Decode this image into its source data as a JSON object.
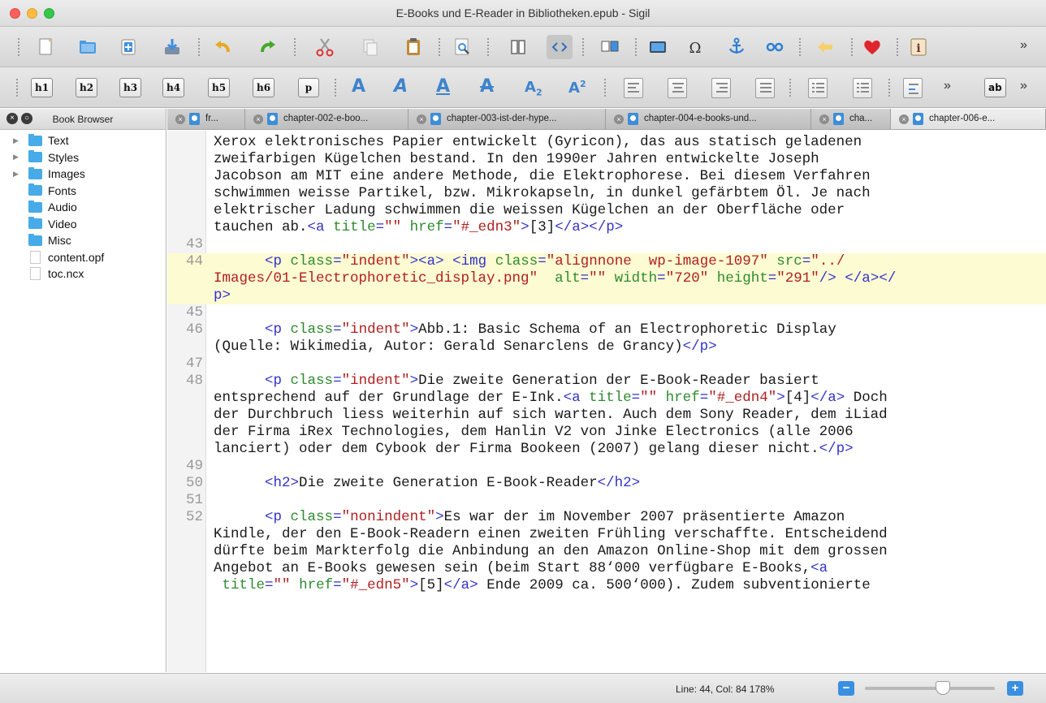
{
  "window": {
    "title": "E-Books und E-Reader in Bibliotheken.epub - Sigil"
  },
  "toolbar1": {
    "more": "»",
    "icons": [
      "new-file-icon",
      "open-folder-icon",
      "add-file-icon",
      "save-icon",
      "undo-icon",
      "redo-icon",
      "cut-icon",
      "copy-icon",
      "paste-icon",
      "find-replace-icon",
      "book-view-icon",
      "code-view-icon",
      "split-view-icon",
      "insert-image-icon",
      "special-character-icon",
      "anchor-icon",
      "link-icon",
      "back-arrow-icon",
      "heart-icon",
      "metadata-icon"
    ]
  },
  "toolbar2": {
    "headings": [
      "h1",
      "h2",
      "h3",
      "h4",
      "h5",
      "h6",
      "p"
    ],
    "format_glyphs": {
      "bold": "A",
      "italic": "A",
      "underline": "A",
      "strike": "A",
      "subscript": "A",
      "subscript_digit": "2",
      "superscript": "A",
      "superscript_digit": "2"
    },
    "ab_label": "ab",
    "more": "»"
  },
  "sidebar": {
    "title": "Book Browser",
    "items": [
      {
        "label": "Text",
        "type": "folder",
        "expandable": true
      },
      {
        "label": "Styles",
        "type": "folder",
        "expandable": true
      },
      {
        "label": "Images",
        "type": "folder",
        "expandable": true
      },
      {
        "label": "Fonts",
        "type": "folder",
        "expandable": false
      },
      {
        "label": "Audio",
        "type": "folder",
        "expandable": false
      },
      {
        "label": "Video",
        "type": "folder",
        "expandable": false
      },
      {
        "label": "Misc",
        "type": "folder",
        "expandable": false
      },
      {
        "label": "content.opf",
        "type": "file",
        "expandable": false
      },
      {
        "label": "toc.ncx",
        "type": "file",
        "expandable": false
      }
    ]
  },
  "tabs": [
    {
      "label": "fr..."
    },
    {
      "label": "chapter-002-e-boo..."
    },
    {
      "label": "chapter-003-ist-der-hype..."
    },
    {
      "label": "chapter-004-e-books-und..."
    },
    {
      "label": "cha..."
    },
    {
      "label": "chapter-006-e..."
    }
  ],
  "editor": {
    "lines": [
      {
        "num": "",
        "text": "Xerox elektronisches Papier entwickelt (Gyricon), das aus statisch geladenen"
      },
      {
        "num": "",
        "text": "zweifarbigen Kügelchen bestand. In den 1990er Jahren entwickelte Joseph"
      },
      {
        "num": "",
        "text": "Jacobson am MIT eine andere Methode, die Elektrophorese. Bei diesem Verfahren"
      },
      {
        "num": "",
        "text": "schwimmen weisse Partikel, bzw. Mikrokapseln, in dunkel gefärbtem Öl. Je nach"
      },
      {
        "num": "",
        "text": "elektrischer Ladung schwimmen die weissen Kügelchen an der Oberfläche oder"
      },
      {
        "num": "",
        "text": "tauchen ab.<a title=\"\" href=\"#_edn3\">[3]</a></p>"
      },
      {
        "num": "43",
        "text": ""
      },
      {
        "num": "44",
        "text": "      <p class=\"indent\"><a> <img class=\"alignnone  wp-image-1097\" src=\"../"
      },
      {
        "num": "",
        "text": "Images/01-Electrophoretic_display.png\" alt=\"\" width=\"720\" height=\"291\"/> </a></"
      },
      {
        "num": "",
        "text": "p>"
      },
      {
        "num": "45",
        "text": ""
      },
      {
        "num": "46",
        "text": "      <p class=\"indent\">Abb.1: Basic Schema of an Electrophoretic Display"
      },
      {
        "num": "",
        "text": "(Quelle: Wikimedia, Autor: Gerald Senarclens de Grancy)</p>"
      },
      {
        "num": "47",
        "text": ""
      },
      {
        "num": "48",
        "text": "      <p class=\"indent\">Die zweite Generation der E-Book-Reader basiert"
      },
      {
        "num": "",
        "text": "entsprechend auf der Grundlage der E-Ink.<a title=\"\" href=\"#_edn4\">[4]</a> Doch"
      },
      {
        "num": "",
        "text": "der Durchbruch liess weiterhin auf sich warten. Auch dem Sony Reader, dem iLiad"
      },
      {
        "num": "",
        "text": "der Firma iRex Technologies, dem Hanlin V2 von Jinke Electronics (alle 2006"
      },
      {
        "num": "",
        "text": "lanciert) oder dem Cybook der Firma Bookeen (2007) gelang dieser nicht.</p>"
      },
      {
        "num": "49",
        "text": ""
      },
      {
        "num": "50",
        "text": "      <h2>Die zweite Generation E-Book-Reader</h2>"
      },
      {
        "num": "51",
        "text": ""
      },
      {
        "num": "52",
        "text": "      <p class=\"nonindent\">Es war der im November 2007 präsentierte Amazon"
      },
      {
        "num": "",
        "text": "Kindle, der den E-Book-Readern einen zweiten Frühling verschaffte. Entscheidend"
      },
      {
        "num": "",
        "text": "dürfte beim Markterfolg die Anbindung an den Amazon Online-Shop mit dem grossen"
      },
      {
        "num": "",
        "text": "Angebot an E-Books gewesen sein (beim Start 88‘000 verfügbare E-Books,<a"
      },
      {
        "num": "",
        "text": "title=\"\" href=\"#_edn5\">[5]</a> Ende 2009 ca. 500‘000). Zudem subventionierte"
      }
    ]
  },
  "statusbar": {
    "position": "Line: 44, Col: 84",
    "zoom": "178%",
    "minus": "−",
    "plus": "+",
    "zoom_level": 0.6
  },
  "colors": {
    "tag": "#3333c8",
    "attr": "#2e8b2e",
    "string": "#b02020",
    "highlight": "#fdfbd2",
    "accent": "#3b8fe0"
  }
}
